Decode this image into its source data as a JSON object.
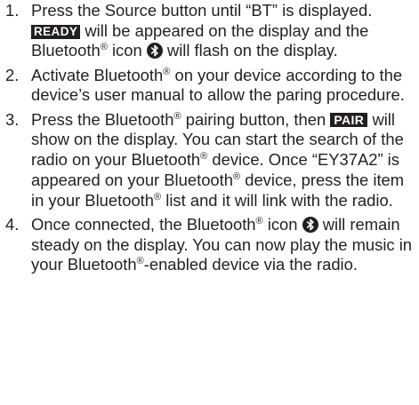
{
  "steps": [
    {
      "number": "1.",
      "t1": "Press the Source button until “BT” is displayed. ",
      "badge": "READY",
      "t2": " will be appeared on the display and the Bluetooth",
      "reg": "®",
      "t3": " icon ",
      "t4": " will flash on the display."
    },
    {
      "number": "2.",
      "t1": "Activate Bluetooth",
      "reg": "®",
      "t2": " on your device according to the device’s user manual to allow the paring procedure."
    },
    {
      "number": "3.",
      "t1": "Press the Bluetooth",
      "reg1": "®",
      "t2": " pairing button, then ",
      "badge": "PAIR",
      "t3": " will show on the display. You can start the search of the radio on your Bluetooth",
      "reg2": "®",
      "t4": " device. Once “EY37A2” is appeared on your Bluetooth",
      "reg3": "®",
      "t5": " device, press the item in your Bluetooth",
      "reg4": "®",
      "t6": " list and it will link with the radio."
    },
    {
      "number": "4.",
      "t1": "Once connected, the Bluetooth",
      "reg1": "®",
      "t2": " icon ",
      "t3": " will remain steady on the display. You can now play the music in your Bluetooth",
      "reg2": "®",
      "t4": "-enabled device via the radio."
    }
  ],
  "icons": {
    "bluetooth": "bluetooth-icon"
  },
  "colors": {
    "text": "#231f20",
    "badge_bg": "#231f20",
    "badge_text": "#ffffff"
  }
}
